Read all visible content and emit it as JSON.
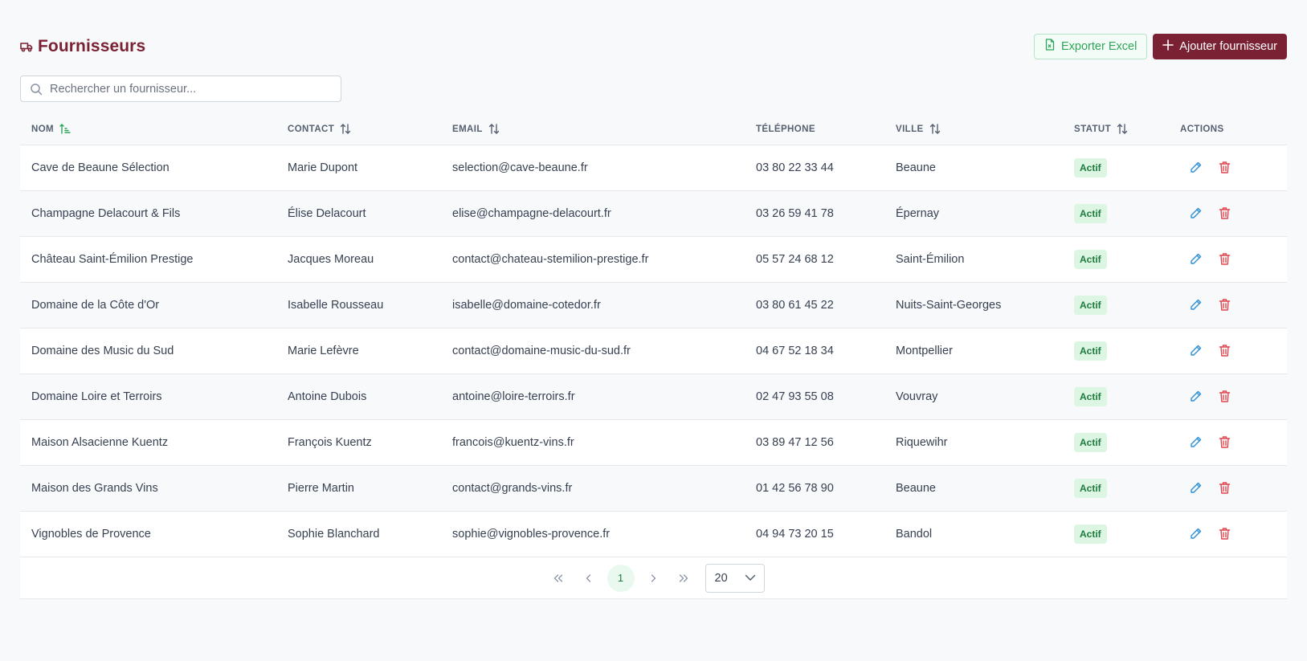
{
  "header": {
    "title": "Fournisseurs",
    "export_label": "Exporter Excel",
    "add_label": "Ajouter fournisseur"
  },
  "search": {
    "placeholder": "Rechercher un fournisseur...",
    "value": ""
  },
  "table": {
    "columns": [
      "Nom",
      "Contact",
      "Email",
      "Téléphone",
      "Ville",
      "Statut",
      "Actions"
    ],
    "sorted_column": "Nom",
    "rows": [
      {
        "nom": "Cave de Beaune Sélection",
        "contact": "Marie Dupont",
        "email": "selection@cave-beaune.fr",
        "telephone": "03 80 22 33 44",
        "ville": "Beaune",
        "statut": "Actif"
      },
      {
        "nom": "Champagne Delacourt & Fils",
        "contact": "Élise Delacourt",
        "email": "elise@champagne-delacourt.fr",
        "telephone": "03 26 59 41 78",
        "ville": "Épernay",
        "statut": "Actif"
      },
      {
        "nom": "Château Saint-Émilion Prestige",
        "contact": "Jacques Moreau",
        "email": "contact@chateau-stemilion-prestige.fr",
        "telephone": "05 57 24 68 12",
        "ville": "Saint-Émilion",
        "statut": "Actif"
      },
      {
        "nom": "Domaine de la Côte d'Or",
        "contact": "Isabelle Rousseau",
        "email": "isabelle@domaine-cotedor.fr",
        "telephone": "03 80 61 45 22",
        "ville": "Nuits-Saint-Georges",
        "statut": "Actif"
      },
      {
        "nom": "Domaine des Music du Sud",
        "contact": "Marie Lefèvre",
        "email": "contact@domaine-music-du-sud.fr",
        "telephone": "04 67 52 18 34",
        "ville": "Montpellier",
        "statut": "Actif"
      },
      {
        "nom": "Domaine Loire et Terroirs",
        "contact": "Antoine Dubois",
        "email": "antoine@loire-terroirs.fr",
        "telephone": "02 47 93 55 08",
        "ville": "Vouvray",
        "statut": "Actif"
      },
      {
        "nom": "Maison Alsacienne Kuentz",
        "contact": "François Kuentz",
        "email": "francois@kuentz-vins.fr",
        "telephone": "03 89 47 12 56",
        "ville": "Riquewihr",
        "statut": "Actif"
      },
      {
        "nom": "Maison des Grands Vins",
        "contact": "Pierre Martin",
        "email": "contact@grands-vins.fr",
        "telephone": "01 42 56 78 90",
        "ville": "Beaune",
        "statut": "Actif"
      },
      {
        "nom": "Vignobles de Provence",
        "contact": "Sophie Blanchard",
        "email": "sophie@vignobles-provence.fr",
        "telephone": "04 94 73 20 15",
        "ville": "Bandol",
        "statut": "Actif"
      }
    ]
  },
  "pagination": {
    "current_page": "1",
    "page_size": "20"
  },
  "colors": {
    "brand": "#7a2233",
    "export_green": "#2fa55a",
    "badge_bg": "#dcf6e3",
    "badge_text": "#1e7a3d",
    "edit_blue": "#2b8fd6",
    "delete_red": "#e0464f"
  }
}
